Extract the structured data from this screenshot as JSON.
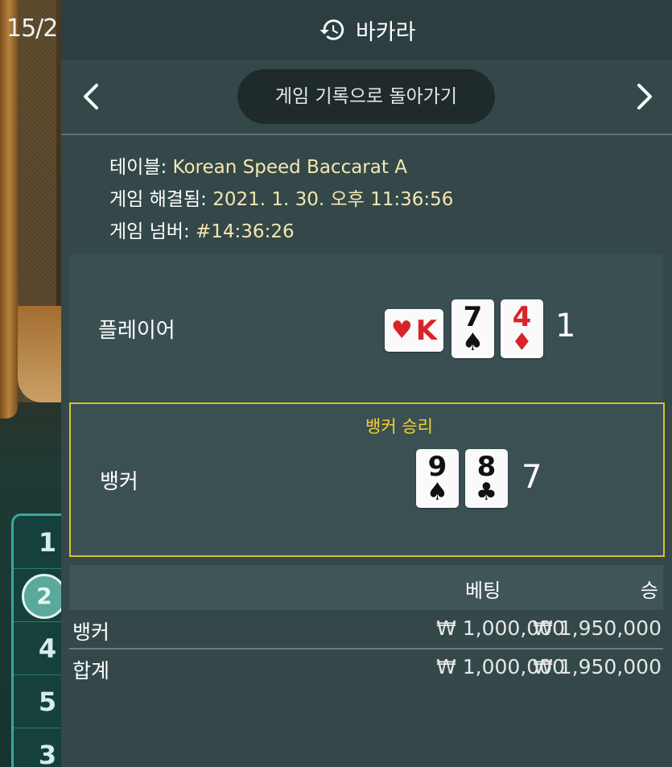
{
  "background": {
    "corner_text": "15/2",
    "bead_road": [
      "1",
      "2",
      "4",
      "5",
      "3"
    ]
  },
  "header": {
    "title": "바카라",
    "icon": "history-icon"
  },
  "nav": {
    "back_label": "게임 기록으로 돌아가기",
    "prev_icon": "chevron-left-icon",
    "next_icon": "chevron-right-icon"
  },
  "info": {
    "table_label": "테이블:",
    "table_value": "Korean Speed Baccarat A",
    "resolved_label": "게임 해결됨:",
    "resolved_value": "2021. 1. 30. 오후 11:36:56",
    "number_label": "게임 넘버:",
    "number_value": "#14:36:26"
  },
  "result": {
    "player": {
      "label": "플레이어",
      "cards": [
        {
          "rank": "K",
          "suit": "♥",
          "color": "#d8232a",
          "orientation": "horizontal"
        },
        {
          "rank": "7",
          "suit": "♠",
          "color": "#111111"
        },
        {
          "rank": "4",
          "suit": "♦",
          "color": "#d8232a"
        }
      ],
      "total": "1"
    },
    "banker": {
      "label": "뱅커",
      "win_label": "뱅커 승리",
      "cards": [
        {
          "rank": "9",
          "suit": "♠",
          "color": "#111111"
        },
        {
          "rank": "8",
          "suit": "♣",
          "color": "#111111"
        }
      ],
      "total": "7"
    },
    "highlight_color": "#d8c12a"
  },
  "bets": {
    "headers": {
      "bet": "베팅",
      "win": "승"
    },
    "rows": [
      {
        "name": "뱅커",
        "bet": "₩ 1,000,000",
        "win": "₩ 1,950,000"
      },
      {
        "name": "합계",
        "bet": "₩ 1,000,000",
        "win": "₩ 1,950,000"
      }
    ]
  }
}
